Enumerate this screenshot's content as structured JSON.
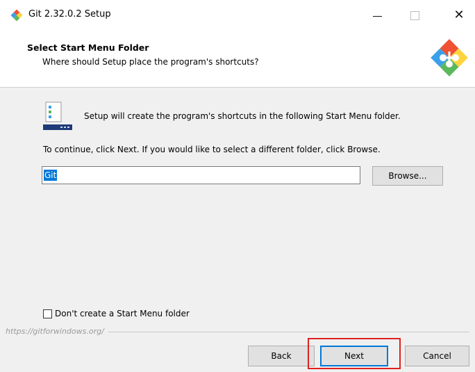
{
  "window": {
    "title": "Git 2.32.0.2 Setup",
    "icons": {
      "app": "git-logo-icon",
      "minimize": "minimize-icon",
      "maximize": "maximize-icon",
      "close": "close-icon"
    },
    "close_glyph": "✕"
  },
  "header": {
    "title": "Select Start Menu Folder",
    "subtitle": "Where should Setup place the program's shortcuts?"
  },
  "body": {
    "intro": "Setup will create the program's shortcuts in the following Start Menu folder.",
    "instruction": "To continue, click Next. If you would like to select a different folder, click Browse.",
    "folder_input_value": "Git",
    "browse_label": "Browse...",
    "checkbox_label": "Don't create a Start Menu folder",
    "checkbox_checked": false
  },
  "footer": {
    "link": "https://gitforwindows.org/",
    "back_label": "Back",
    "next_label": "Next",
    "cancel_label": "Cancel"
  },
  "colors": {
    "accent": "#0078d7",
    "highlight": "#e02020",
    "git_orange": "#f05133",
    "git_yellow": "#ffd43b",
    "git_green": "#5cb85c",
    "git_blue": "#3aa0e8"
  }
}
